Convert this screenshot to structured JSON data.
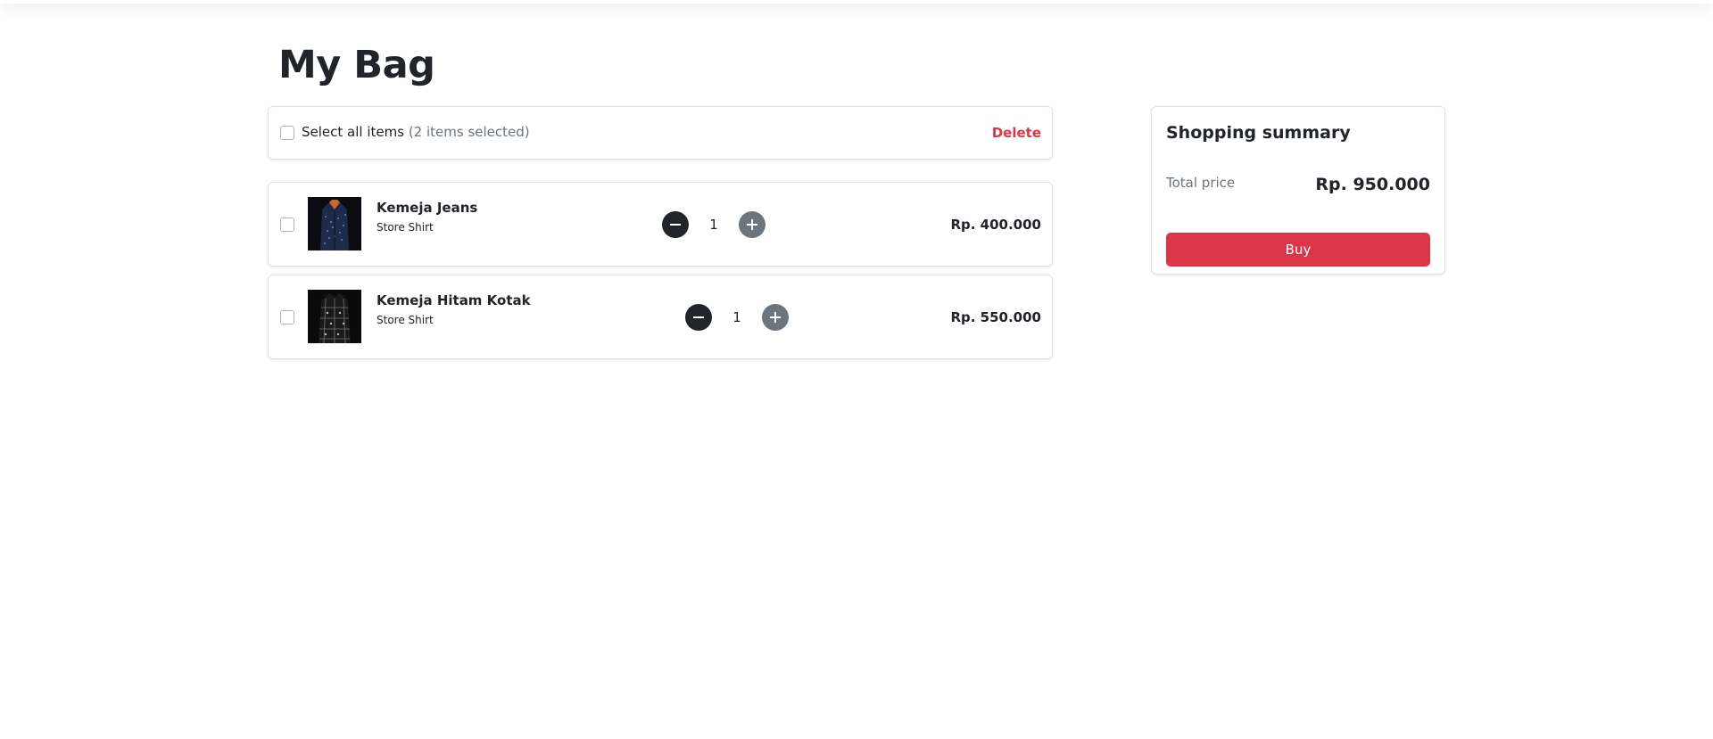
{
  "page": {
    "title": "My Bag"
  },
  "select_bar": {
    "label": "Select all items",
    "count_text": "(2 items selected)",
    "delete_label": "Delete"
  },
  "items": [
    {
      "name": "Kemeja Jeans",
      "store": "Store Shirt",
      "quantity": "1",
      "price": "Rp. 400.000",
      "thumbnail": "denim-shirt-image"
    },
    {
      "name": "Kemeja Hitam Kotak",
      "store": "Store Shirt",
      "quantity": "1",
      "price": "Rp. 550.000",
      "thumbnail": "black-plaid-shirt-image"
    }
  ],
  "summary": {
    "title": "Shopping summary",
    "total_label": "Total price",
    "total_value": "Rp. 950.000",
    "buy_label": "Buy"
  },
  "colors": {
    "accent": "#dc3545",
    "text": "#212529",
    "muted": "#6c757d"
  }
}
